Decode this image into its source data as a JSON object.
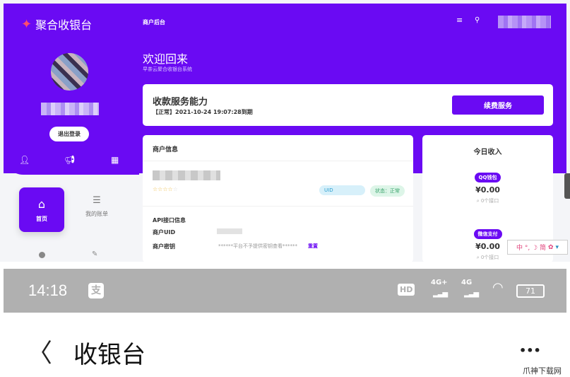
{
  "brand": {
    "name": "聚合收银台",
    "accent": "#6a0af3"
  },
  "header": {
    "section": "商户后台",
    "menu_icon": "menu-icon",
    "search_icon": "search-icon"
  },
  "sidebar": {
    "logout": "退出登录",
    "nav": [
      {
        "label": "首页",
        "icon": "home-icon",
        "active": true
      },
      {
        "label": "我的账单",
        "icon": "list-check-icon",
        "active": false
      }
    ]
  },
  "welcome": {
    "title": "欢迎回来",
    "subtitle": "早茶云聚合收银台系统"
  },
  "service": {
    "title": "收款服务能力",
    "expiry": "【正常】2021-10-24 19:07:28到期",
    "renew": "续费服务"
  },
  "merchant": {
    "title": "商户信息",
    "rating": 4,
    "uid_label": "UID",
    "status": "状态：正常",
    "api_title": "API接口信息",
    "uid_row": "商户UID",
    "key_row": "商户密钥",
    "key_value": "******平台不予提供密钥查看******",
    "reset": "重置"
  },
  "income": {
    "title": "今日收入",
    "items": [
      {
        "tag": "QQ钱包",
        "amount": "¥0.00",
        "count": "0个接口"
      },
      {
        "tag": "微信支付",
        "amount": "¥0.00",
        "count": "0个接口"
      }
    ]
  },
  "ime": {
    "text": "中 °, ☽ 简"
  },
  "phone": {
    "time": "14:18",
    "battery": "71",
    "network1": "4G+",
    "network2": "4G",
    "hd": "HD",
    "title": "收银台",
    "more": "•••"
  },
  "watermark": "爪神下载网"
}
